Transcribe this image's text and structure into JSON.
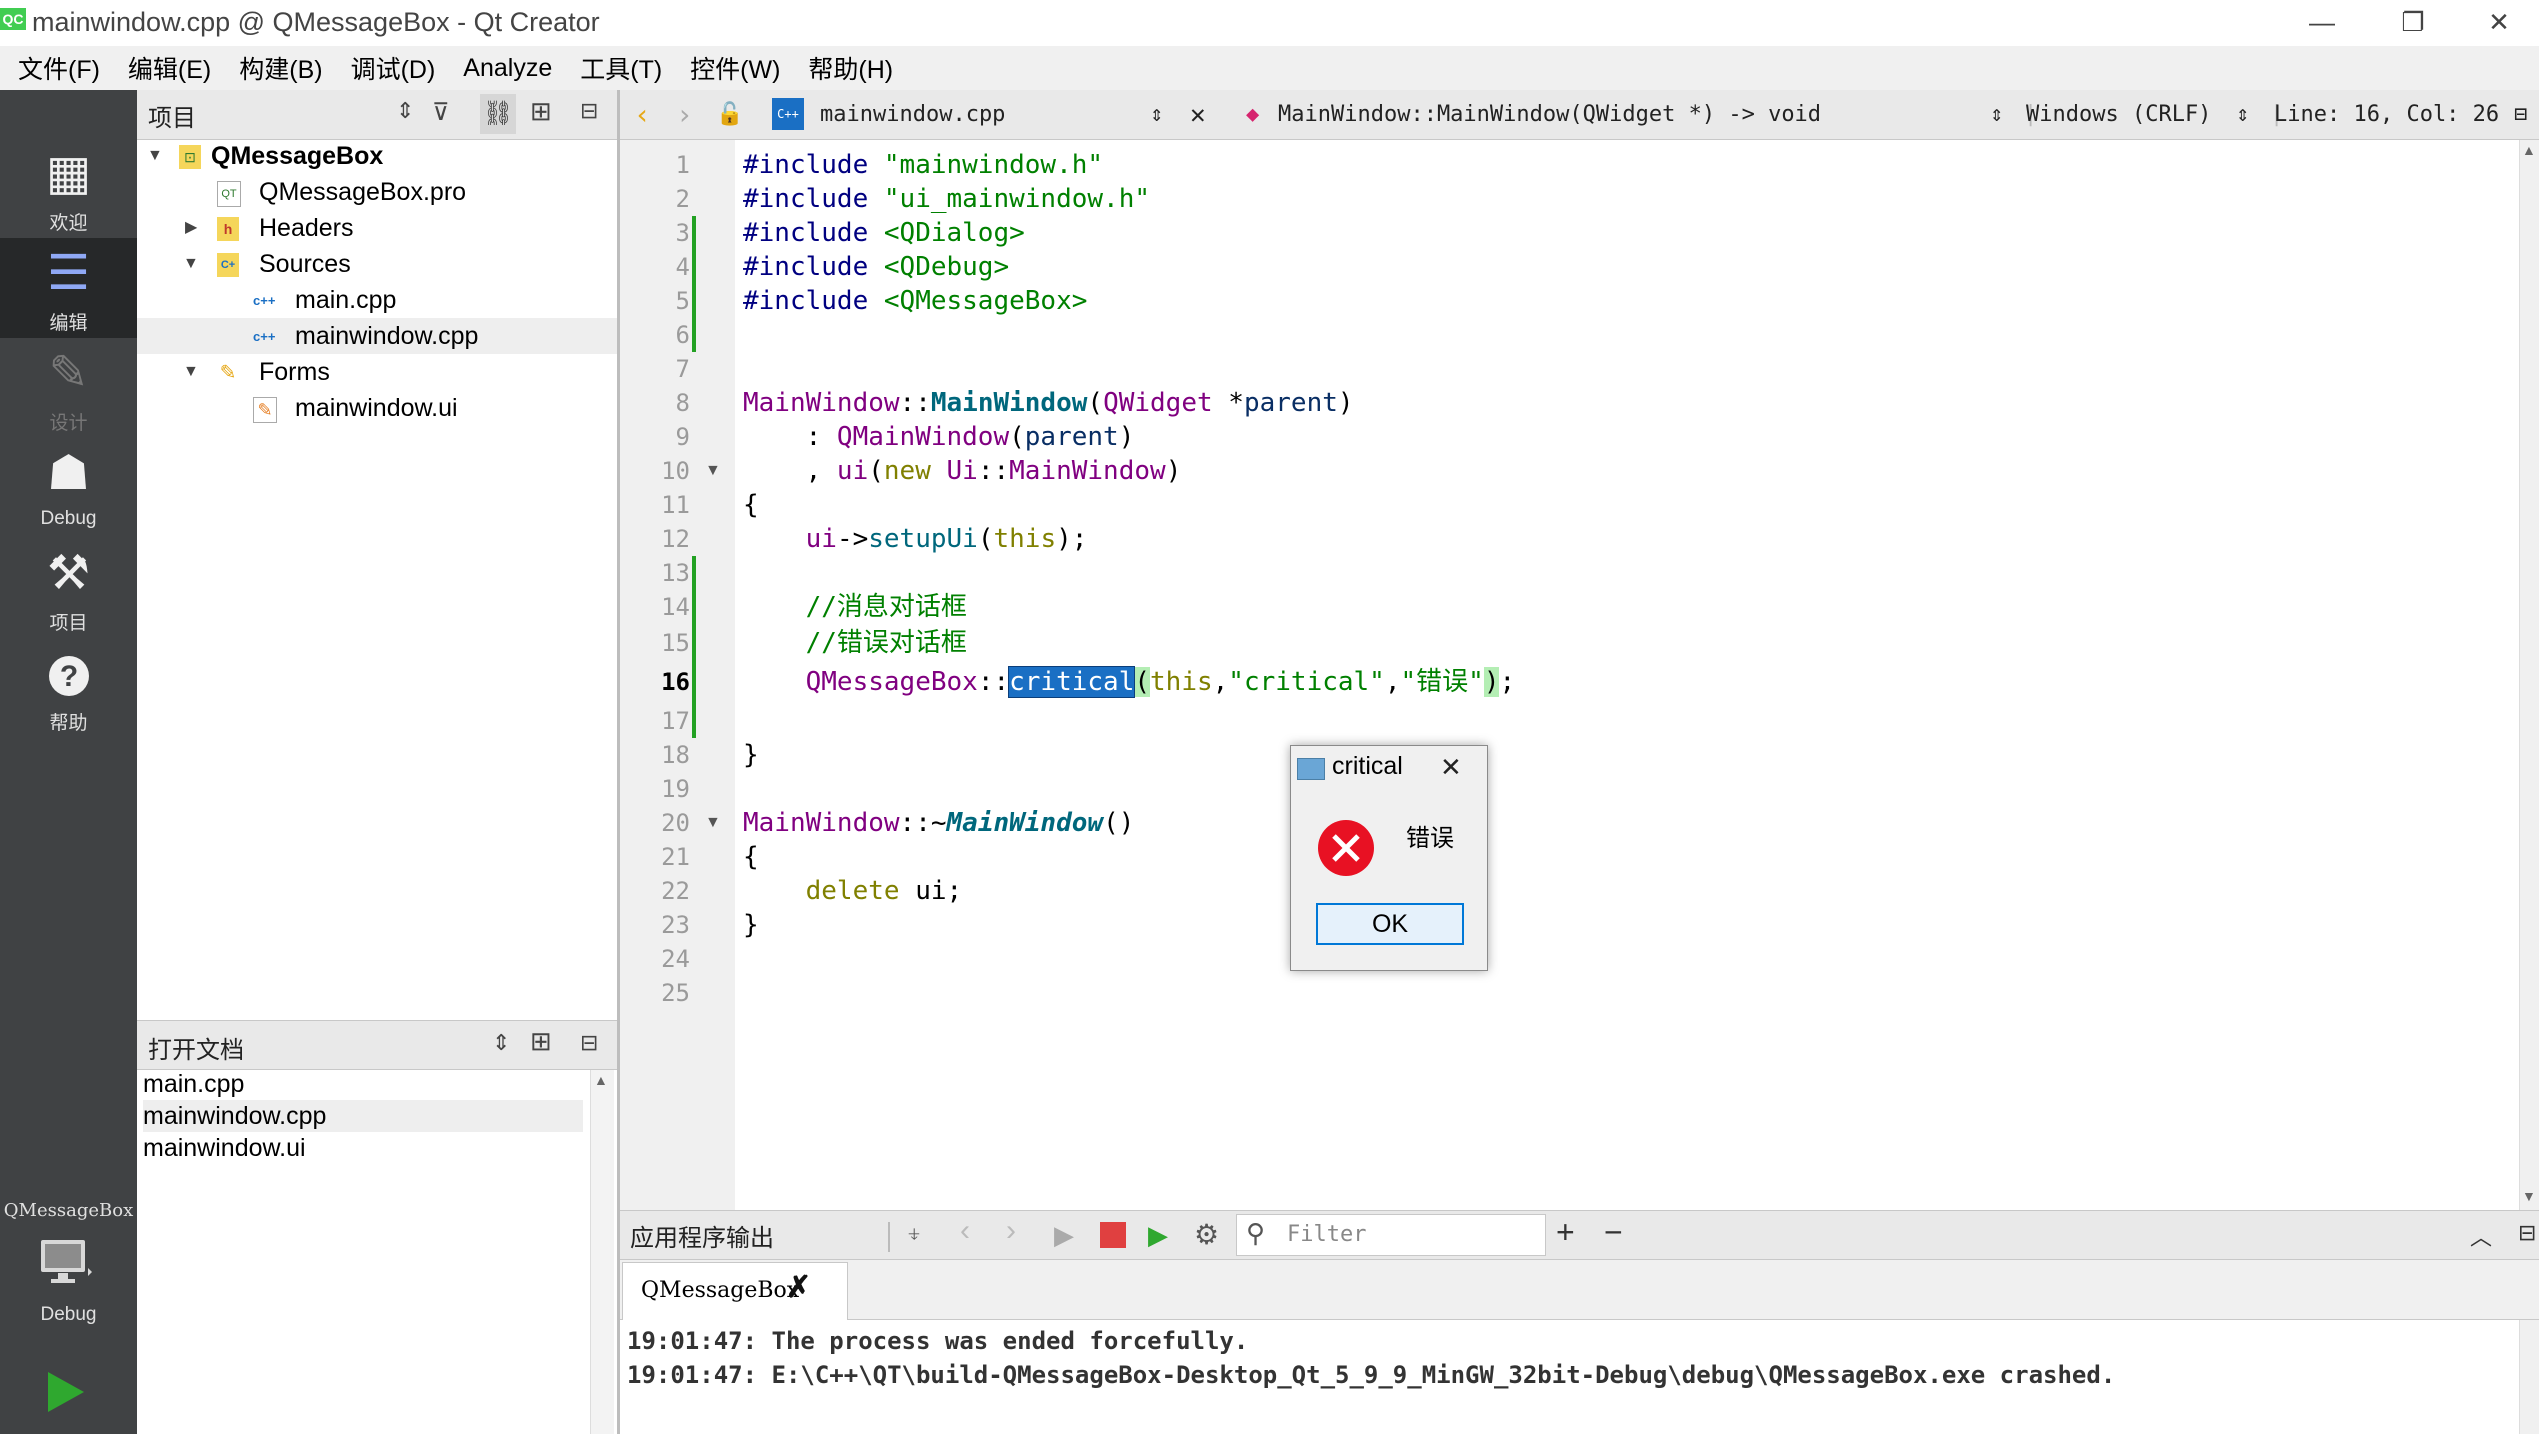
{
  "window": {
    "title": "mainwindow.cpp @ QMessageBox - Qt Creator",
    "app_icon_text": "QC",
    "controls": {
      "minimize": "—",
      "restore": "❐",
      "close": "✕"
    }
  },
  "menu": [
    "文件(F)",
    "编辑(E)",
    "构建(B)",
    "调试(D)",
    "Analyze",
    "工具(T)",
    "控件(W)",
    "帮助(H)"
  ],
  "modes": [
    {
      "label": "欢迎",
      "icon": "grid-icon",
      "glyph": "▦"
    },
    {
      "label": "编辑",
      "icon": "edit-document-icon",
      "glyph": "☰"
    },
    {
      "label": "设计",
      "icon": "pencil-icon",
      "glyph": "✎"
    },
    {
      "label": "Debug",
      "icon": "bug-icon",
      "glyph": "☗"
    },
    {
      "label": "项目",
      "icon": "wrench-icon",
      "glyph": "⚒"
    },
    {
      "label": "帮助",
      "icon": "help-icon",
      "glyph": "?"
    }
  ],
  "projects_panel": {
    "title": "项目",
    "tree": {
      "root": "QMessageBox",
      "pro_file": "QMessageBox.pro",
      "headers": "Headers",
      "sources": "Sources",
      "source_files": [
        "main.cpp",
        "mainwindow.cpp"
      ],
      "forms": "Forms",
      "form_files": [
        "mainwindow.ui"
      ]
    }
  },
  "open_documents": {
    "title": "打开文档",
    "items": [
      "main.cpp",
      "mainwindow.cpp",
      "mainwindow.ui"
    ]
  },
  "editor_toolbar": {
    "file": "mainwindow.cpp",
    "symbol": "MainWindow::MainWindow(QWidget *) -> void",
    "line_ending": "Windows (CRLF)",
    "position": "Line: 16, Col: 26"
  },
  "code": {
    "line_numbers": [
      "1",
      "2",
      "3",
      "4",
      "5",
      "6",
      "7",
      "8",
      "9",
      "10",
      "11",
      "12",
      "13",
      "14",
      "15",
      "16",
      "17",
      "18",
      "19",
      "20",
      "21",
      "22",
      "23",
      "24",
      "25"
    ],
    "current_line": "16",
    "l1": {
      "kw": "#include",
      "str": "\"mainwindow.h\""
    },
    "l2": {
      "kw": "#include",
      "str": "\"ui_mainwindow.h\""
    },
    "l3": {
      "kw": "#include",
      "str": "<QDialog>"
    },
    "l4": {
      "kw": "#include",
      "str": "<QDebug>"
    },
    "l5": {
      "kw": "#include",
      "str": "<QMessageBox>"
    },
    "l8": {
      "cls": "MainWindow",
      "sep": "::",
      "fn": "MainWindow",
      "open": "(",
      "type": "QWidget",
      "rest": " *",
      "param": "parent",
      "close": ")"
    },
    "l9": {
      "lead": "    : ",
      "fn": "QMainWindow",
      "open": "(",
      "param": "parent",
      "close": ")"
    },
    "l10": {
      "lead": "    , ",
      "fn": "ui",
      "open": "(",
      "kw": "new",
      "sp": " ",
      "ns": "Ui",
      "sep": "::",
      "type": "MainWindow",
      "close": ")"
    },
    "l11": "{",
    "l12": {
      "lead": "    ",
      "obj": "ui",
      "arrow": "->",
      "fn": "setupUi",
      "open": "(",
      "kw": "this",
      "close": ");"
    },
    "l14": "    //消息对话框",
    "l15": "    //错误对话框",
    "l16": {
      "lead": "    ",
      "cls": "QMessageBox",
      "sep": "::",
      "fn": "critical",
      "open": "(",
      "kw": "this",
      "c1": ",",
      "s1": "\"critical\"",
      "c2": ",",
      "s2": "\"错误\"",
      "close": ")",
      "semi": ";"
    },
    "l18": "}",
    "l20": {
      "cls": "MainWindow",
      "sep": "::~",
      "fn": "MainWindow",
      "paren": "()"
    },
    "l21": "{",
    "l22": {
      "lead": "    ",
      "kw": "delete",
      "rest": " ui;"
    },
    "l23": "}"
  },
  "output": {
    "title": "应用程序输出",
    "filter_placeholder": "Filter",
    "tab": "QMessageBox",
    "lines": [
      "19:01:47: The process was ended forcefully.",
      "19:01:47: E:\\C++\\QT\\build-QMessageBox-Desktop_Qt_5_9_9_MinGW_32bit-Debug\\debug\\QMessageBox.exe crashed."
    ]
  },
  "run_target": {
    "project": "QMessageBox",
    "mode": "Debug"
  },
  "message_box": {
    "title": "critical",
    "text": "错误",
    "ok": "OK",
    "icon": "error-icon",
    "icon_color": "#e81123"
  },
  "colors": {
    "sidebar": "#404244",
    "selection": "#1a6fc4",
    "run_green": "#2fa82f",
    "stop_red": "#e04040"
  }
}
